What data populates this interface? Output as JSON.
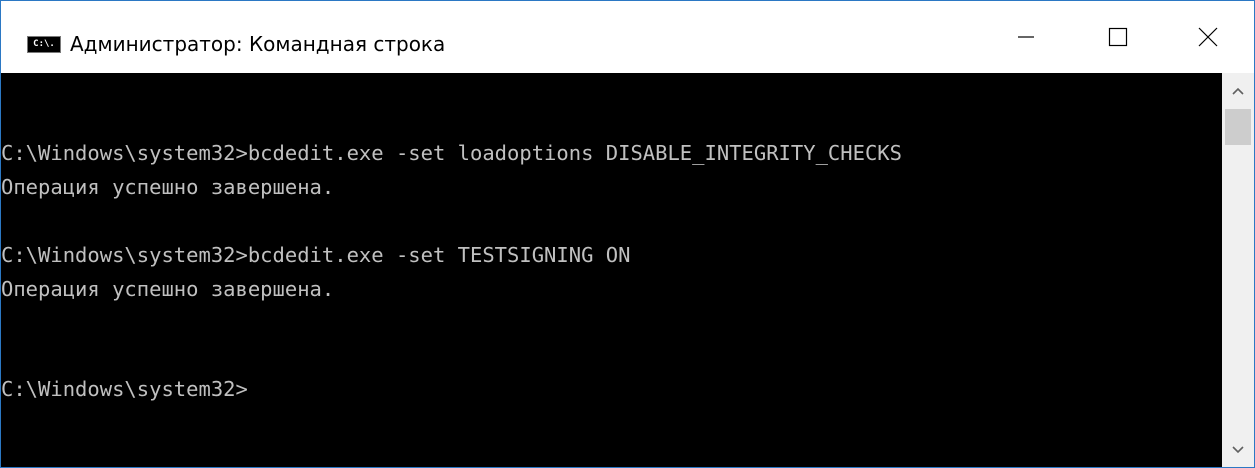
{
  "window": {
    "title": "Администратор: Командная строка",
    "icon": "cmd-icon",
    "icon_text": "C:\\."
  },
  "controls": {
    "minimize": "minimize-icon",
    "maximize": "maximize-icon",
    "close": "close-icon"
  },
  "console": {
    "lines": [
      "C:\\Windows\\system32>bcdedit.exe -set loadoptions DISABLE_INTEGRITY_CHECKS",
      "Операция успешно завершена.",
      "C:\\Windows\\system32>bcdedit.exe -set TESTSIGNING ON",
      "Операция успешно завершена.",
      "C:\\Windows\\system32>"
    ],
    "text_color": "#c0c0c0",
    "background": "#000000"
  },
  "scrollbar": {
    "up": "chevron-up-icon",
    "down": "chevron-down-icon"
  }
}
